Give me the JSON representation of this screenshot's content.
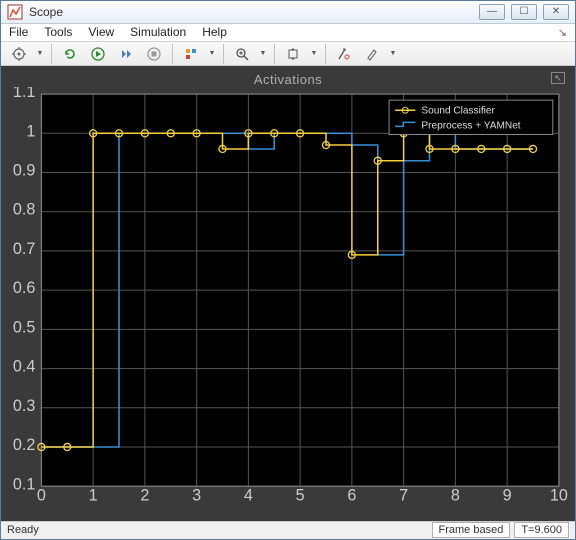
{
  "window": {
    "title": "Scope"
  },
  "menu": {
    "file": "File",
    "tools": "Tools",
    "view": "View",
    "simulation": "Simulation",
    "help": "Help"
  },
  "status": {
    "ready": "Ready",
    "frame": "Frame based",
    "time": "T=9.600"
  },
  "chart_data": {
    "type": "line",
    "title": "Activations",
    "xlim": [
      0,
      10
    ],
    "ylim": [
      0.1,
      1.1
    ],
    "xticks": [
      0,
      1,
      2,
      3,
      4,
      5,
      6,
      7,
      8,
      9,
      10
    ],
    "yticks": [
      0.1,
      0.2,
      0.3,
      0.4,
      0.5,
      0.6,
      0.7,
      0.8,
      0.9,
      1,
      1.1
    ],
    "legend": {
      "position": "top-right",
      "entries": [
        "Sound Classifier",
        "Preprocess + YAMNet"
      ]
    },
    "series": [
      {
        "name": "Sound Classifier",
        "color": "#f5d040",
        "marker": "o",
        "x": [
          0.0,
          0.5,
          1.0,
          1.5,
          2.0,
          2.5,
          3.0,
          3.5,
          4.0,
          4.5,
          5.0,
          5.5,
          6.0,
          6.5,
          7.0,
          7.5,
          8.0,
          8.5,
          9.0,
          9.5
        ],
        "y": [
          0.2,
          0.2,
          1.0,
          1.0,
          1.0,
          1.0,
          1.0,
          0.96,
          1.0,
          1.0,
          1.0,
          0.97,
          0.69,
          0.93,
          1.0,
          0.96,
          0.96,
          0.96,
          0.96,
          0.96
        ]
      },
      {
        "name": "Preprocess + YAMNet",
        "color": "#3a90d8",
        "marker": "none",
        "x": [
          0.0,
          0.5,
          1.0,
          1.5,
          2.0,
          2.5,
          3.0,
          3.5,
          4.0,
          4.5,
          5.0,
          5.5,
          6.0,
          6.5,
          7.0,
          7.5,
          8.0,
          8.5,
          9.0,
          9.5
        ],
        "y": [
          0.2,
          0.2,
          0.2,
          1.0,
          1.0,
          1.0,
          1.0,
          1.0,
          0.96,
          1.0,
          1.0,
          1.0,
          0.97,
          0.69,
          0.93,
          1.0,
          0.96,
          0.96,
          0.96,
          0.96
        ]
      }
    ]
  }
}
